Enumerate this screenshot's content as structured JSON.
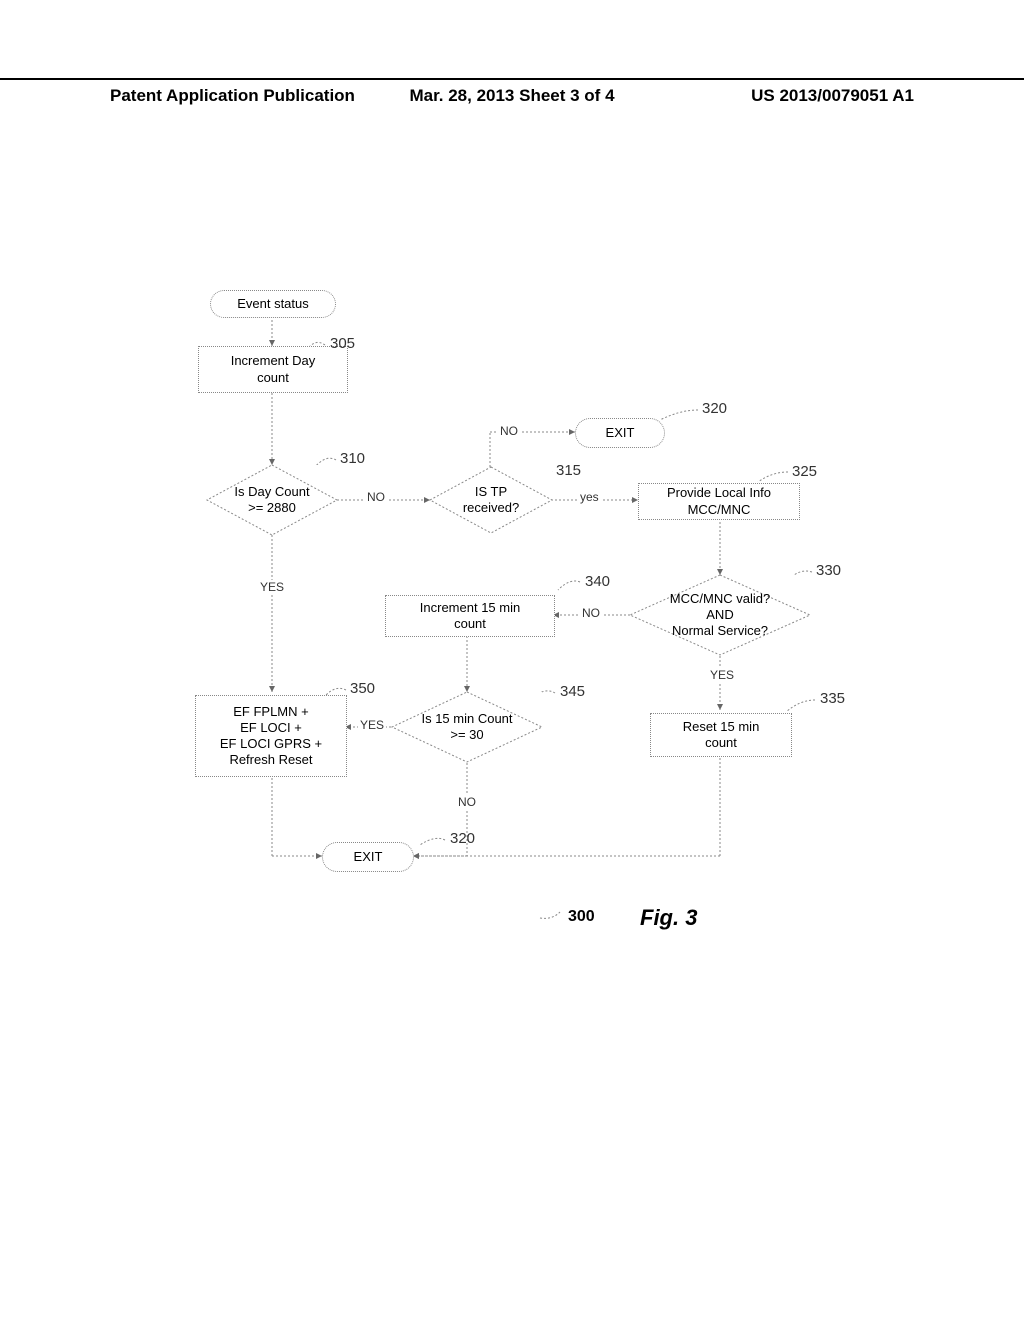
{
  "header": {
    "left": "Patent Application Publication",
    "center": "Mar. 28, 2013  Sheet 3 of 4",
    "right": "US 2013/0079051 A1"
  },
  "nodes": {
    "event_status": "Event status",
    "increment_day": "Increment Day\ncount",
    "day_count_q": "Is Day Count\n>= 2880",
    "tp_q": "IS TP\nreceived?",
    "exit": "EXIT",
    "local_info": "Provide Local Info\nMCC/MNC",
    "mccmnc_q": "MCC/MNC valid?\nAND\nNormal Service?",
    "reset15": "Reset 15 min\ncount",
    "inc15": "Increment 15 min\ncount",
    "count15_q": "Is 15 min Count\n>= 30",
    "reset_all": "EF FPLMN +\nEF LOCI +\nEF LOCI GPRS +\nRefresh Reset",
    "exit2": "EXIT"
  },
  "refs": {
    "r305": "305",
    "r310": "310",
    "r315": "315",
    "r320": "320",
    "r325": "325",
    "r330": "330",
    "r335": "335",
    "r340": "340",
    "r345": "345",
    "r350": "350",
    "r320b": "320",
    "r300": "300"
  },
  "edge_labels": {
    "no1": "NO",
    "no2": "NO",
    "yes1": "yes",
    "yes2": "YES",
    "no3": "NO",
    "yes3": "YES",
    "yes4": "YES",
    "no4": "NO"
  },
  "figure": {
    "caption": "Fig. 3"
  }
}
